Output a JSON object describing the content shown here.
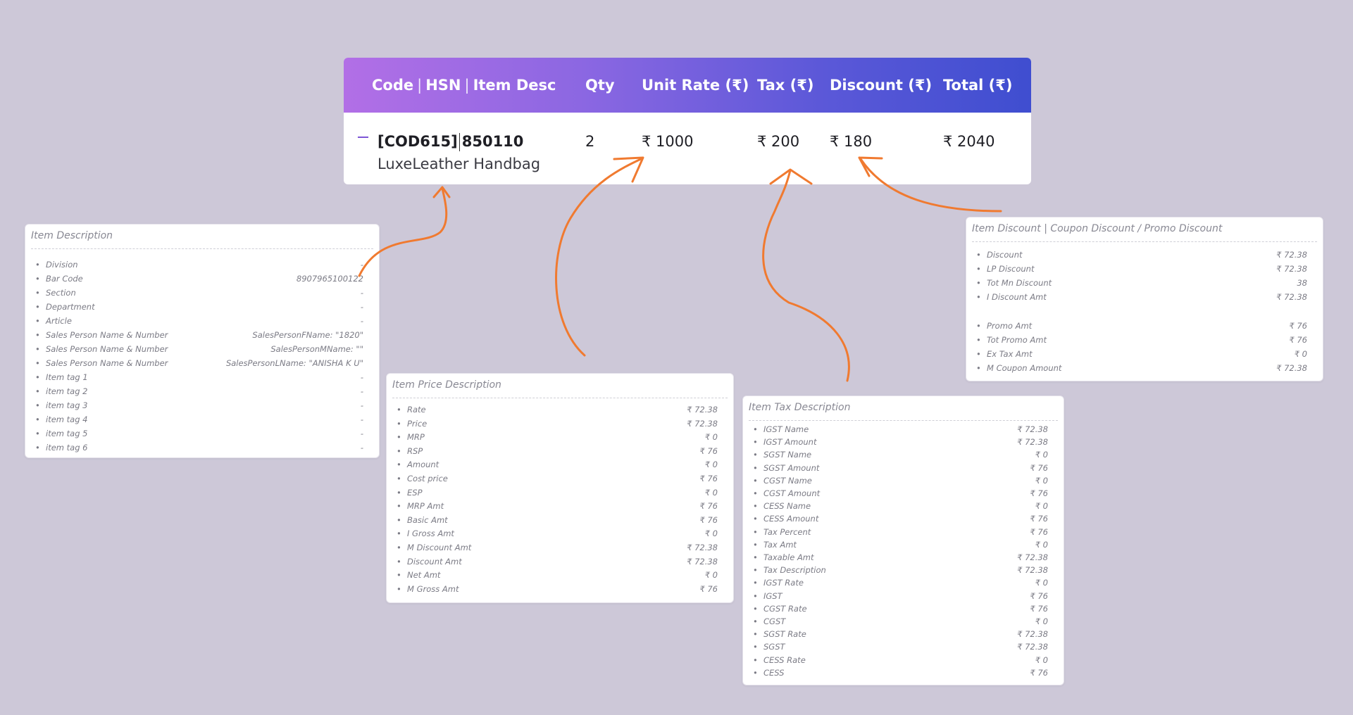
{
  "table": {
    "headers": {
      "code": "Code",
      "hsn": "HSN",
      "desc": "Item Desc",
      "sep": "|",
      "qty": "Qty",
      "unit_rate": "Unit Rate (₹)",
      "tax": "Tax (₹)",
      "discount": "Discount (₹)",
      "total": "Total (₹)"
    },
    "row": {
      "code": "[COD615]",
      "hsn": "850110",
      "item_name": "LuxeLeather Handbag",
      "qty": "2",
      "unit_rate": "₹ 1000",
      "tax": "₹ 200",
      "discount": "₹ 180",
      "total": "₹ 2040"
    }
  },
  "item_desc": {
    "title": "Item Description",
    "rows": [
      {
        "label": "Division",
        "value": "-"
      },
      {
        "label": "Bar Code",
        "value": "8907965100122"
      },
      {
        "label": "Section",
        "value": "-"
      },
      {
        "label": "Department",
        "value": "-"
      },
      {
        "label": "Article",
        "value": "-"
      },
      {
        "label": "Sales Person Name & Number",
        "value": "SalesPersonFName: \"1820\""
      },
      {
        "label": "Sales Person Name & Number",
        "value": "SalesPersonMName: \"\""
      },
      {
        "label": "Sales Person Name & Number",
        "value": "SalesPersonLName: \"ANISHA K U\""
      },
      {
        "label": "Item tag 1",
        "value": "-"
      },
      {
        "label": "item tag 2",
        "value": "-"
      },
      {
        "label": "item tag 3",
        "value": "-"
      },
      {
        "label": "item tag 4",
        "value": "-"
      },
      {
        "label": "item tag 5",
        "value": "-"
      },
      {
        "label": "item tag 6",
        "value": "-"
      }
    ]
  },
  "price_desc": {
    "title": "Item Price Description",
    "rows": [
      {
        "label": "Rate",
        "value": "₹ 72.38"
      },
      {
        "label": "Price",
        "value": "₹ 72.38"
      },
      {
        "label": "MRP",
        "value": "₹ 0"
      },
      {
        "label": "RSP",
        "value": "₹ 76"
      },
      {
        "label": "Amount",
        "value": "₹ 0"
      },
      {
        "label": "Cost price",
        "value": "₹ 76"
      },
      {
        "label": "ESP",
        "value": "₹ 0"
      },
      {
        "label": "MRP Amt",
        "value": "₹ 76"
      },
      {
        "label": "Basic Amt",
        "value": "₹ 76"
      },
      {
        "label": "I Gross Amt",
        "value": "₹ 0"
      },
      {
        "label": "M Discount Amt",
        "value": "₹ 72.38"
      },
      {
        "label": "Discount Amt",
        "value": "₹ 72.38"
      },
      {
        "label": "Net Amt",
        "value": "₹ 0"
      },
      {
        "label": "M Gross Amt",
        "value": "₹ 76"
      }
    ]
  },
  "tax_desc": {
    "title": "Item Tax Description",
    "rows": [
      {
        "label": "IGST Name",
        "value": "₹ 72.38"
      },
      {
        "label": "IGST Amount",
        "value": "₹ 72.38"
      },
      {
        "label": "SGST Name",
        "value": "₹ 0"
      },
      {
        "label": "SGST Amount",
        "value": "₹ 76"
      },
      {
        "label": "CGST Name",
        "value": "₹ 0"
      },
      {
        "label": "CGST Amount",
        "value": "₹ 76"
      },
      {
        "label": "CESS Name",
        "value": "₹ 0"
      },
      {
        "label": "CESS Amount",
        "value": "₹ 76"
      },
      {
        "label": "Tax Percent",
        "value": "₹ 76"
      },
      {
        "label": "Tax Amt",
        "value": "₹ 0"
      },
      {
        "label": "Taxable Amt",
        "value": "₹ 72.38"
      },
      {
        "label": "Tax Description",
        "value": "₹ 72.38"
      },
      {
        "label": "IGST Rate",
        "value": "₹ 0"
      },
      {
        "label": "IGST",
        "value": "₹ 76"
      },
      {
        "label": "CGST Rate",
        "value": "₹ 76"
      },
      {
        "label": "CGST",
        "value": "₹ 0"
      },
      {
        "label": "SGST Rate",
        "value": "₹ 72.38"
      },
      {
        "label": "SGST",
        "value": "₹ 72.38"
      },
      {
        "label": "CESS Rate",
        "value": "₹ 0"
      },
      {
        "label": "CESS",
        "value": "₹ 76"
      }
    ]
  },
  "discount_desc": {
    "title": "Item Discount | Coupon Discount / Promo Discount",
    "rows": [
      {
        "label": "Discount",
        "value": "₹ 72.38"
      },
      {
        "label": "LP Discount",
        "value": "₹ 72.38"
      },
      {
        "label": "Tot Mn Discount",
        "value": "38"
      },
      {
        "label": "I Discount Amt",
        "value": "₹ 72.38"
      },
      {
        "label": "Promo Amt",
        "value": "₹ 76"
      },
      {
        "label": "Tot Promo Amt",
        "value": "₹ 76"
      },
      {
        "label": "Ex Tax Amt",
        "value": "₹ 0"
      },
      {
        "label": "M Coupon Amount",
        "value": "₹ 72.38"
      }
    ]
  },
  "colors": {
    "background": "#cdc8d8",
    "header_gradient_start": "#b26fe6",
    "header_gradient_end": "#3f4ed0",
    "arrow": "#f07a30"
  }
}
